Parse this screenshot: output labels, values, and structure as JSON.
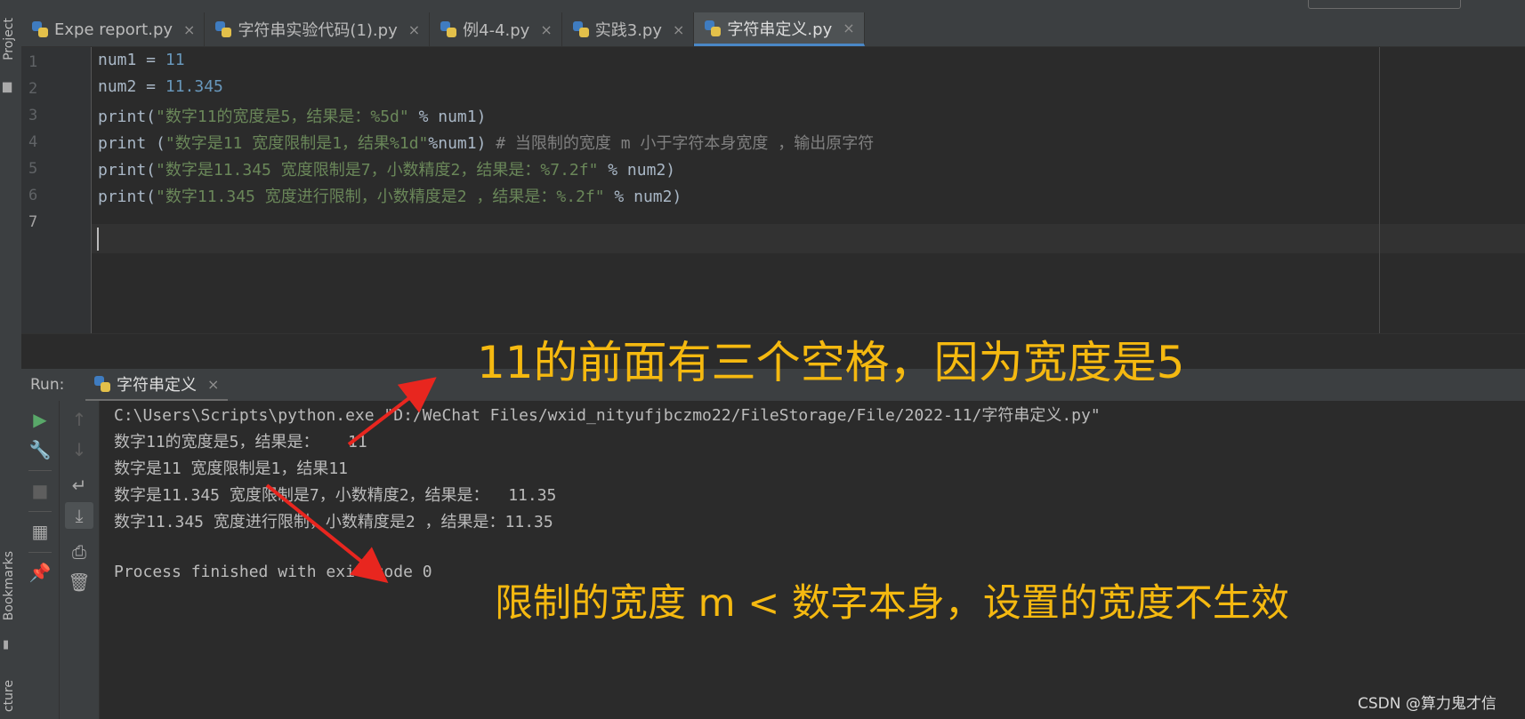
{
  "left_strip": {
    "project_label": "Project",
    "bookmarks_label": "Bookmarks",
    "structure_label": "cture"
  },
  "tabs": [
    {
      "label": "Expe report.py",
      "close": "×",
      "active": false
    },
    {
      "label": "字符串实验代码(1).py",
      "close": "×",
      "active": false
    },
    {
      "label": "例4-4.py",
      "close": "×",
      "active": false
    },
    {
      "label": "实践3.py",
      "close": "×",
      "active": false
    },
    {
      "label": "字符串定义.py",
      "close": "×",
      "active": true
    }
  ],
  "editor": {
    "line_numbers": [
      "1",
      "2",
      "3",
      "4",
      "5",
      "6",
      "7"
    ],
    "lines": [
      [
        {
          "t": "num1 = ",
          "c": "plain"
        },
        {
          "t": "11",
          "c": "num"
        }
      ],
      [
        {
          "t": "num2 = ",
          "c": "plain"
        },
        {
          "t": "11.345",
          "c": "num"
        }
      ],
      [
        {
          "t": "print(",
          "c": "plain"
        },
        {
          "t": "\"数字11的宽度是5，结果是：%5d\"",
          "c": "str"
        },
        {
          "t": " % num1)",
          "c": "plain"
        }
      ],
      [
        {
          "t": "print (",
          "c": "plain"
        },
        {
          "t": "\"数字是11 宽度限制是1，结果%1d\"",
          "c": "str"
        },
        {
          "t": "%num1) ",
          "c": "plain"
        },
        {
          "t": "# 当限制的宽度 m 小于字符本身宽度 ，输出原字符",
          "c": "cmt"
        }
      ],
      [
        {
          "t": "print(",
          "c": "plain"
        },
        {
          "t": "\"数字是11.345 宽度限制是7，小数精度2，结果是：%7.2f\"",
          "c": "str"
        },
        {
          "t": " % num2)",
          "c": "plain"
        }
      ],
      [
        {
          "t": "print(",
          "c": "plain"
        },
        {
          "t": "\"数字11.345 宽度进行限制，小数精度是2 ，结果是：%.2f\"",
          "c": "str"
        },
        {
          "t": " % num2)",
          "c": "plain"
        }
      ],
      []
    ]
  },
  "run": {
    "label": "Run:",
    "tab_label": "字符串定义",
    "tab_close": "×",
    "output": [
      "C:\\Users\\Scripts\\python.exe \"D:/WeChat Files/wxid_nityufjbczmo22/FileStorage/File/2022-11/字符串定义.py\"",
      "数字11的宽度是5，结果是：   11",
      "数字是11 宽度限制是1，结果11",
      "数字是11.345 宽度限制是7，小数精度2，结果是：  11.35",
      "数字11.345 宽度进行限制，小数精度是2 ，结果是：11.35",
      "",
      "Process finished with exit code 0"
    ]
  },
  "annotations": {
    "note_1": "11的前面有三个空格，因为宽度是5",
    "note_2": "限制的宽度 m < 数字本身，设置的宽度不生效",
    "color": "#f5b910",
    "arrow_color": "#e8261f"
  },
  "watermark": "CSDN @算力鬼才信",
  "colors": {
    "editor_bg": "#2b2b2b",
    "chrome_bg": "#3c3f41",
    "number": "#6897bb",
    "string": "#6a8759",
    "comment": "#808080",
    "text": "#a9b7c6",
    "accent": "#4a88c7"
  }
}
